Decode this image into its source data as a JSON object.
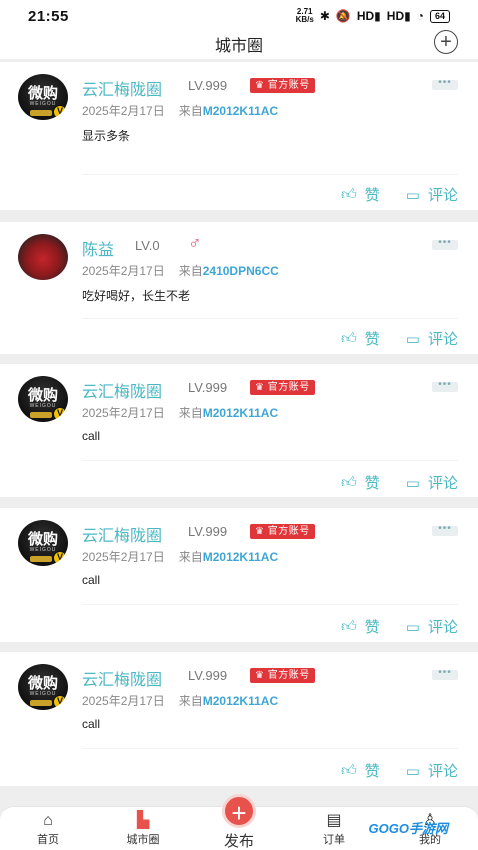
{
  "status_bar": {
    "time": "21:55",
    "net_speed_value": "2.71",
    "net_speed_unit": "KB/s",
    "signal_1": "HD",
    "signal_2": "HD",
    "battery": "64"
  },
  "header": {
    "title": "城市圈"
  },
  "posts": [
    {
      "name": "云汇梅陇圈",
      "level": "LV.999",
      "badge": "官方账号",
      "date": "2025年2月17日",
      "from_label": "来自",
      "device": "M2012K11AC",
      "content": "显示多条",
      "like_label": "赞",
      "comment_label": "评论"
    },
    {
      "name": "陈益",
      "level": "LV.0",
      "gender_icon": "male-icon",
      "date": "2025年2月17日",
      "from_label": "来自",
      "device": "2410DPN6CC",
      "content": "吃好喝好，长生不老",
      "like_label": "赞",
      "comment_label": "评论"
    },
    {
      "name": "云汇梅陇圈",
      "level": "LV.999",
      "badge": "官方账号",
      "date": "2025年2月17日",
      "from_label": "来自",
      "device": "M2012K11AC",
      "content": "call",
      "like_label": "赞",
      "comment_label": "评论"
    },
    {
      "name": "云汇梅陇圈",
      "level": "LV.999",
      "badge": "官方账号",
      "date": "2025年2月17日",
      "from_label": "来自",
      "device": "M2012K11AC",
      "content": "call",
      "like_label": "赞",
      "comment_label": "评论"
    },
    {
      "name": "云汇梅陇圈",
      "level": "LV.999",
      "badge": "官方账号",
      "date": "2025年2月17日",
      "from_label": "来自",
      "device": "M2012K11AC",
      "content": "call",
      "like_label": "赞",
      "comment_label": "评论"
    }
  ],
  "avatar_brand": {
    "logo_text": "微购",
    "logo_sub": "WEIGOU",
    "v_badge": "V"
  },
  "tabbar": {
    "home": "首页",
    "city": "城市圈",
    "publish": "发布",
    "orders": "订单",
    "mine": "我的"
  },
  "watermark": "GOGO手游网",
  "colors": {
    "accent": "#4cb8c4",
    "brand_red": "#e8524c",
    "official_badge": "#e0363a",
    "device_link": "#3ea6d6"
  }
}
